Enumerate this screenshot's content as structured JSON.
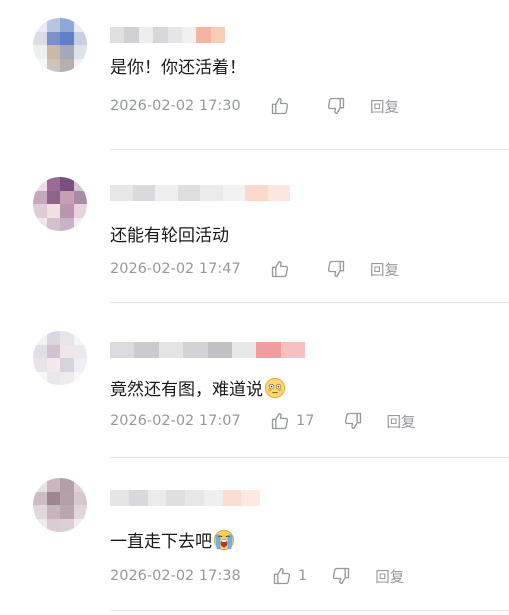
{
  "comments": [
    {
      "text": "是你！你还活着！",
      "emoji": "",
      "time": "2026-02-02 17:30",
      "like_count": "",
      "reply_label": "回复",
      "avatar_colors": [
        "#e6eaf2",
        "#b8c4e0",
        "#8ea8d8",
        "#e9ecf2",
        "#d8dde6",
        "#7b8fc8",
        "#5f7fc9",
        "#c6d0e4",
        "#eef0ee",
        "#c9b9a8",
        "#a3a9b9",
        "#dde3ea",
        "#f4f5f5",
        "#cfc4ba",
        "#b7aeb0",
        "#eef0f2"
      ],
      "name_colors": [
        "#dfe0e2",
        "#cfd1d4",
        "#eceef0",
        "#d6d7da",
        "#e4e5e7",
        "#f1f1f2",
        "#f5b4a0",
        "#f9cbb9"
      ]
    },
    {
      "text": "还能有轮回活动",
      "emoji": "",
      "time": "2026-02-02 17:47",
      "like_count": "",
      "reply_label": "回复",
      "avatar_colors": [
        "#e9dce6",
        "#9b6a97",
        "#7c4f83",
        "#d6c3d6",
        "#c7a7bf",
        "#8d6687",
        "#c79fb5",
        "#a98aa6",
        "#dfcbd6",
        "#f0dfe4",
        "#b896ae",
        "#e6d4dd",
        "#efe6ec",
        "#d3c0cf",
        "#c8b3c6",
        "#f3ecf0"
      ],
      "name_colors": [
        "#e6e7e9",
        "#d9dadd",
        "#eeeff1",
        "#dddee0",
        "#e9eaec",
        "#f2f2f3",
        "#fbd8c9",
        "#fde6dc"
      ]
    },
    {
      "text": "竟然还有图，难道说",
      "emoji": "flushed",
      "time": "2026-02-02 17:07",
      "like_count": "17",
      "reply_label": "回复",
      "avatar_colors": [
        "#f2f1f4",
        "#dcd6e2",
        "#e9e4ea",
        "#f5f4f6",
        "#e3dde6",
        "#cfc3d2",
        "#f0e6ea",
        "#ece9ee",
        "#e7e3ea",
        "#f3e8ec",
        "#d8d2dc",
        "#f0eef2",
        "#f6f5f7",
        "#e9e6ec",
        "#eeebef",
        "#f7f6f8"
      ],
      "name_colors": [
        "#dadbde",
        "#c9cbcf",
        "#e3e4e6",
        "#d1d3d6",
        "#bfc1c5",
        "#e7e8ea",
        "#f29d9d",
        "#f7c0c0"
      ]
    },
    {
      "text": "一直走下去吧",
      "emoji": "crying",
      "time": "2026-02-02 17:38",
      "like_count": "1",
      "reply_label": "回复",
      "avatar_colors": [
        "#e7e1e4",
        "#c9b7bf",
        "#b49ea9",
        "#ddd2d7",
        "#cdbcc4",
        "#9e8591",
        "#b59fa9",
        "#d6c7ce",
        "#e2d7dc",
        "#c7b4bd",
        "#bba6b0",
        "#e0d6db",
        "#efeaec",
        "#d9cdd3",
        "#dccfd5",
        "#f2edef"
      ],
      "name_colors": [
        "#e4e5e7",
        "#d8d9dc",
        "#eaebed",
        "#dedfe1",
        "#e6e7e9",
        "#eeeff0",
        "#fbdcd2",
        "#fde9e1"
      ]
    }
  ]
}
